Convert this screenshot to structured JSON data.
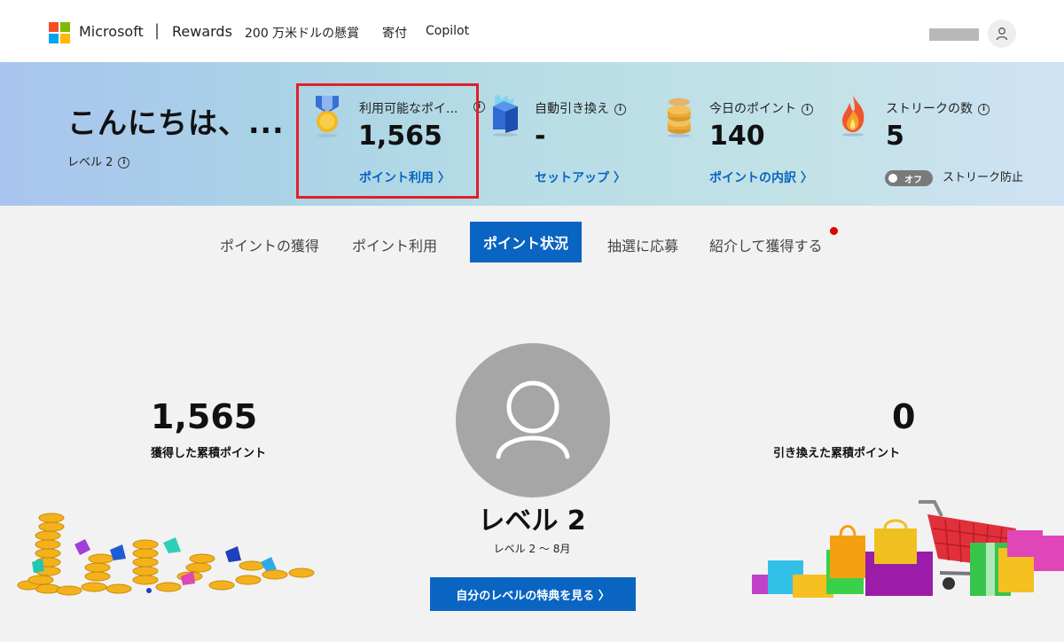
{
  "header": {
    "brand": "Microsoft",
    "separator": "|",
    "section": "Rewards",
    "nav": [
      "200 万米ドルの懸賞",
      "寄付",
      "Copilot"
    ],
    "logo_colors": [
      "#f25022",
      "#7fba00",
      "#00a4ef",
      "#ffb900"
    ]
  },
  "banner": {
    "greeting": "こんにちは、...",
    "level": "レベル 2",
    "stats": [
      {
        "label": "利用可能なポイ...",
        "value": "1,565",
        "link": "ポイント利用 〉",
        "icon": "medal-icon"
      },
      {
        "label": "自動引き換え",
        "value": "-",
        "link": "セットアップ 〉",
        "icon": "gift-box-icon"
      },
      {
        "label": "今日のポイント",
        "value": "140",
        "link": "ポイントの内訳 〉",
        "icon": "coin-stack-icon"
      },
      {
        "label": "ストリークの数",
        "value": "5",
        "icon": "flame-icon"
      }
    ],
    "toggle_label": "オフ",
    "streak_protect": "ストリーク防止",
    "highlight_color": "#e0202a"
  },
  "tabs": {
    "items": [
      "ポイントの獲得",
      "ポイント利用",
      "ポイント状況",
      "抽選に応募",
      "紹介して獲得する"
    ],
    "active": "ポイント状況"
  },
  "main": {
    "earned_value": "1,565",
    "earned_label": "獲得した累積ポイント",
    "redeemed_value": "0",
    "redeemed_label": "引き換えた累積ポイント",
    "level_title": "レベル 2",
    "level_sub": "レベル 2 〜 8月",
    "cta": "自分のレベルの特典を見る 〉"
  },
  "colors": {
    "accent": "#0a64c2",
    "notification": "#e00000"
  }
}
